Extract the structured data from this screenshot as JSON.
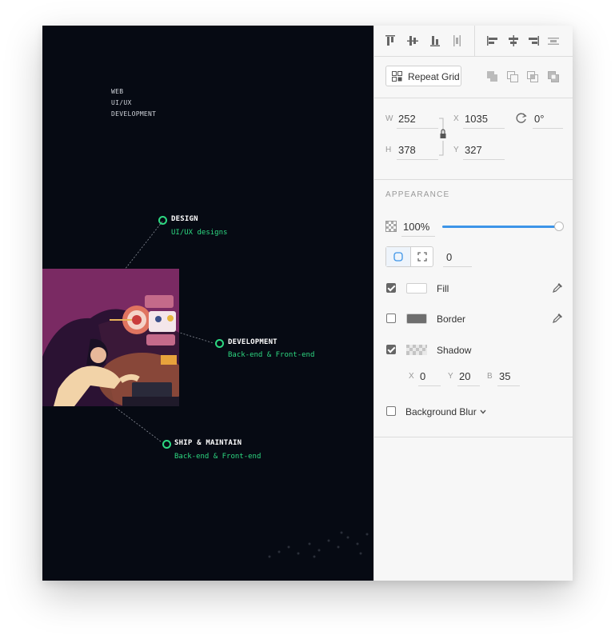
{
  "artboard": {
    "nav": [
      "WEB",
      "UI/UX",
      "DEVELOPMENT"
    ],
    "nodes": [
      {
        "title": "DESIGN",
        "subtitle": "UI/UX designs"
      },
      {
        "title": "DEVELOPMENT",
        "subtitle": "Back-end & Front-end"
      },
      {
        "title": "SHIP & MAINTAIN",
        "subtitle": "Back-end & Front-end"
      }
    ],
    "accent": "#2dd881",
    "background": "#060a13"
  },
  "panel": {
    "align_icons": [
      "align-top-icon",
      "align-middle-icon",
      "align-bottom-icon",
      "distribute-vertical-icon",
      "align-left-icon",
      "align-center-icon",
      "align-right-icon",
      "distribute-horizontal-icon"
    ],
    "repeat_grid_label": "Repeat Grid",
    "boolean_icons": [
      "add-icon",
      "subtract-icon",
      "intersect-icon",
      "exclude-icon"
    ],
    "transform": {
      "w_label": "W",
      "w": "252",
      "h_label": "H",
      "h": "378",
      "x_label": "X",
      "x": "1035",
      "y_label": "Y",
      "y": "327",
      "rotation": "0°"
    },
    "appearance": {
      "heading": "APPEARANCE",
      "opacity": "100%",
      "opacity_level": 1.0,
      "corner_radius": "0",
      "fill_label": "Fill",
      "fill_checked": true,
      "fill_color": "#ffffff",
      "border_label": "Border",
      "border_checked": false,
      "border_color": "#6e6e6e",
      "shadow_label": "Shadow",
      "shadow_checked": true,
      "shadow_x_label": "X",
      "shadow_x": "0",
      "shadow_y_label": "Y",
      "shadow_y": "20",
      "shadow_b_label": "B",
      "shadow_b": "35",
      "blur_label": "Background Blur",
      "blur_checked": false
    },
    "slider_color": "#3d95e8"
  }
}
